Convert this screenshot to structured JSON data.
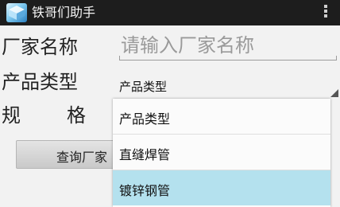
{
  "app": {
    "title": "铁哥们助手",
    "icon": "app-launcher-icon"
  },
  "form": {
    "manufacturer_label": "厂家名称",
    "manufacturer_placeholder": "请输入厂家名称",
    "product_type_label": "产品类型",
    "product_type_selected": "产品类型",
    "spec_label_part1": "规",
    "spec_label_part2": "格",
    "query_button_label": "查询厂家"
  },
  "dropdown": {
    "options": [
      "产品类型",
      "直缝焊管",
      "镀锌钢管"
    ],
    "highlighted_index": 2
  },
  "colors": {
    "action_bar": "#1d1d1d",
    "highlight": "#b4e1ee"
  }
}
